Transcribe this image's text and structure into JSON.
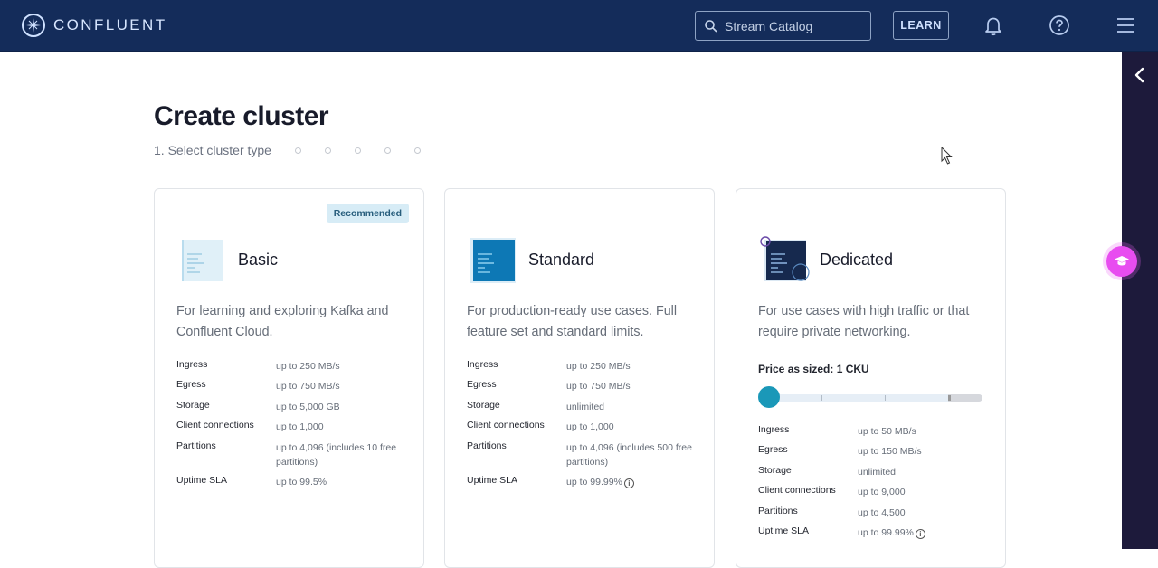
{
  "header": {
    "brand": "CONFLUENT",
    "search": {
      "placeholder": "Stream Catalog"
    },
    "learn_label": "LEARN"
  },
  "page": {
    "title": "Create cluster",
    "step_label": "1. Select cluster type",
    "step_dots": 5
  },
  "cards": [
    {
      "name": "Basic",
      "badge": "Recommended",
      "description": "For learning and exploring Kafka and Confluent Cloud.",
      "specs": [
        {
          "label": "Ingress",
          "value": "up to 250 MB/s"
        },
        {
          "label": "Egress",
          "value": "up to 750 MB/s"
        },
        {
          "label": "Storage",
          "value": "up to 5,000 GB"
        },
        {
          "label": "Client connections",
          "value": "up to 1,000"
        },
        {
          "label": "Partitions",
          "value": "up to 4,096 (includes 10 free partitions)"
        },
        {
          "label": "Uptime SLA",
          "value": "up to 99.5%"
        }
      ]
    },
    {
      "name": "Standard",
      "description": "For production-ready use cases. Full feature set and standard limits.",
      "specs": [
        {
          "label": "Ingress",
          "value": "up to 250 MB/s"
        },
        {
          "label": "Egress",
          "value": "up to 750 MB/s"
        },
        {
          "label": "Storage",
          "value": "unlimited"
        },
        {
          "label": "Client connections",
          "value": "up to 1,000"
        },
        {
          "label": "Partitions",
          "value": "up to 4,096 (includes 500 free partitions)"
        },
        {
          "label": "Uptime SLA",
          "value": "up to 99.99%"
        }
      ]
    },
    {
      "name": "Dedicated",
      "description": "For use cases with high traffic or that require private networking.",
      "price_label": "Price as sized: 1 CKU",
      "cku_slider_position": 0,
      "specs": [
        {
          "label": "Ingress",
          "value": "up to 50 MB/s"
        },
        {
          "label": "Egress",
          "value": "up to 150 MB/s"
        },
        {
          "label": "Storage",
          "value": "unlimited"
        },
        {
          "label": "Client connections",
          "value": "up to 9,000"
        },
        {
          "label": "Partitions",
          "value": "up to 4,500"
        },
        {
          "label": "Uptime SLA",
          "value": "up to 99.99%"
        }
      ]
    }
  ],
  "colors": {
    "topbar": "#142c5a",
    "sidepanel": "#1d1a3b",
    "accent": "#1a98b8",
    "help_fab": "#e84df0"
  },
  "icons": {
    "logo": "confluent-logo-icon",
    "search": "search-icon",
    "notifications": "bell-icon",
    "help": "question-circle-icon",
    "menu": "hamburger-menu-icon",
    "collapse": "chevron-left-icon",
    "fab": "graduation-cap-icon"
  }
}
